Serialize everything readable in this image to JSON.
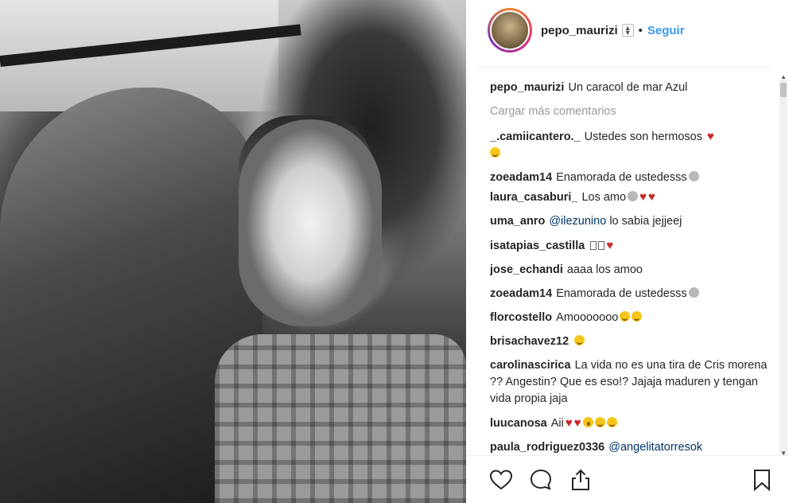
{
  "post": {
    "username": "pepo_maurizi",
    "separator": "•",
    "follow_label": "Seguir",
    "caption": {
      "user": "pepo_maurizi",
      "text": "Un caracol de mar Azul"
    },
    "load_more_label": "Cargar más comentarios",
    "comments": [
      {
        "user": "_.camiicantero._",
        "text": "Ustedes son hermosos"
      },
      {
        "user": "zoeadam14",
        "text": "Enamorada de ustedesss"
      },
      {
        "user": "laura_casaburi_",
        "text": "Los amo"
      },
      {
        "user": "uma_anro",
        "mention": "@ilezunino",
        "text": "lo sabia jejjeej"
      },
      {
        "user": "isatapias_castilla",
        "text": ""
      },
      {
        "user": "jose_echandi",
        "text": "aaaa los amoo"
      },
      {
        "user": "zoeadam14",
        "text": "Enamorada de ustedesss"
      },
      {
        "user": "florcostello",
        "text": "Amooooooo"
      },
      {
        "user": "brisachavez12",
        "text": ""
      },
      {
        "user": "carolinascirica",
        "text": "La vida no es una tira de Cris morena ?? Angestin? Que es eso!? Jajaja maduren y tengan vida propia jaja"
      },
      {
        "user": "luucanosa",
        "text": "Aii"
      },
      {
        "user": "paula_rodriguez0336",
        "mention": "@angelitatorresok",
        "text": ""
      }
    ]
  },
  "icons": {
    "like": "heart-outline-icon",
    "comment": "speech-bubble-icon",
    "share": "share-upload-icon",
    "save": "bookmark-icon"
  },
  "colors": {
    "follow": "#3897f0",
    "mention": "#003569",
    "heart": "#c62828"
  }
}
